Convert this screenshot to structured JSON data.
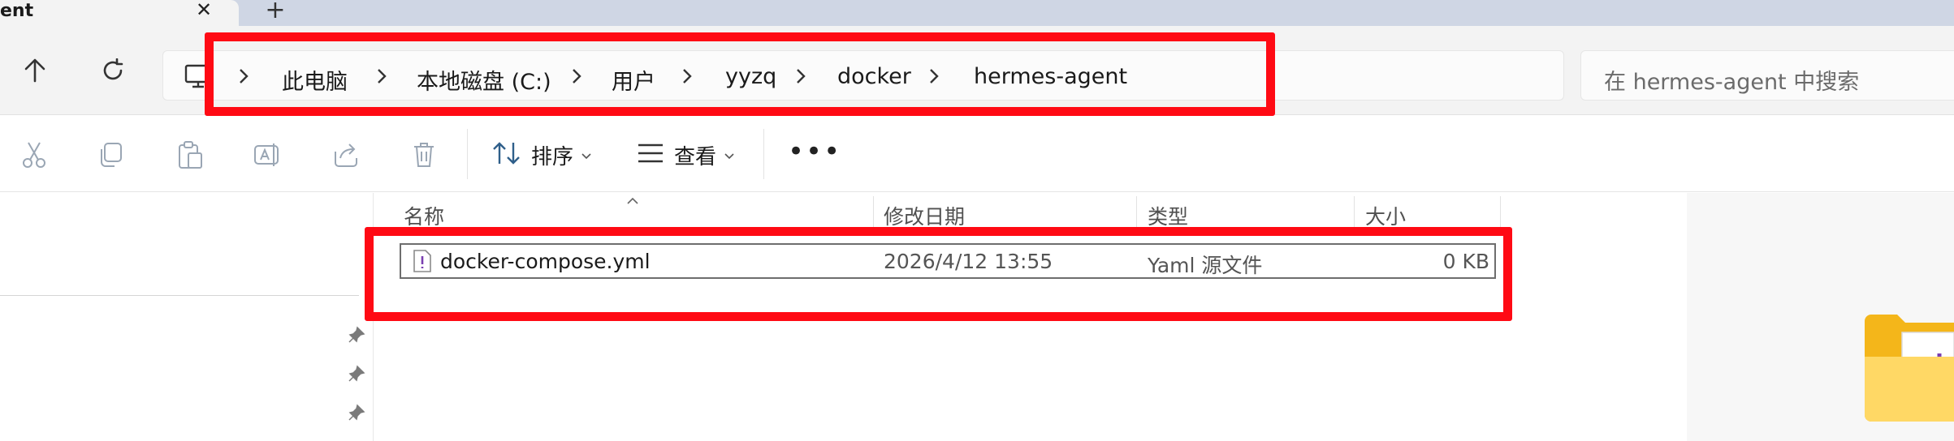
{
  "tab": {
    "title": "ent",
    "close_glyph": "✕",
    "new_glyph": "+"
  },
  "breadcrumb": {
    "items": [
      "此电脑",
      "本地磁盘 (C:)",
      "用户",
      "yyzq",
      "docker",
      "hermes-agent"
    ]
  },
  "search": {
    "placeholder": "在 hermes-agent 中搜索"
  },
  "toolbar": {
    "sort_label": "排序",
    "view_label": "查看",
    "more_label": "•••"
  },
  "columns": {
    "name": "名称",
    "modified": "修改日期",
    "type": "类型",
    "size": "大小"
  },
  "files": [
    {
      "name": "docker-compose.yml",
      "modified": "2026/4/12 13:55",
      "type": "Yaml 源文件",
      "size": "0 KB"
    }
  ],
  "colors": {
    "highlight": "#ff0a14",
    "tabstrip": "#cfd6e4",
    "accent": "#005fb8"
  },
  "icons": [
    "up-arrow-icon",
    "refresh-icon",
    "this-pc-icon",
    "chevron-right-icon",
    "cut-icon",
    "copy-icon",
    "paste-icon",
    "rename-icon",
    "share-icon",
    "delete-icon",
    "sort-icon",
    "view-icon",
    "pin-icon",
    "yaml-file-icon",
    "folder-icon"
  ]
}
